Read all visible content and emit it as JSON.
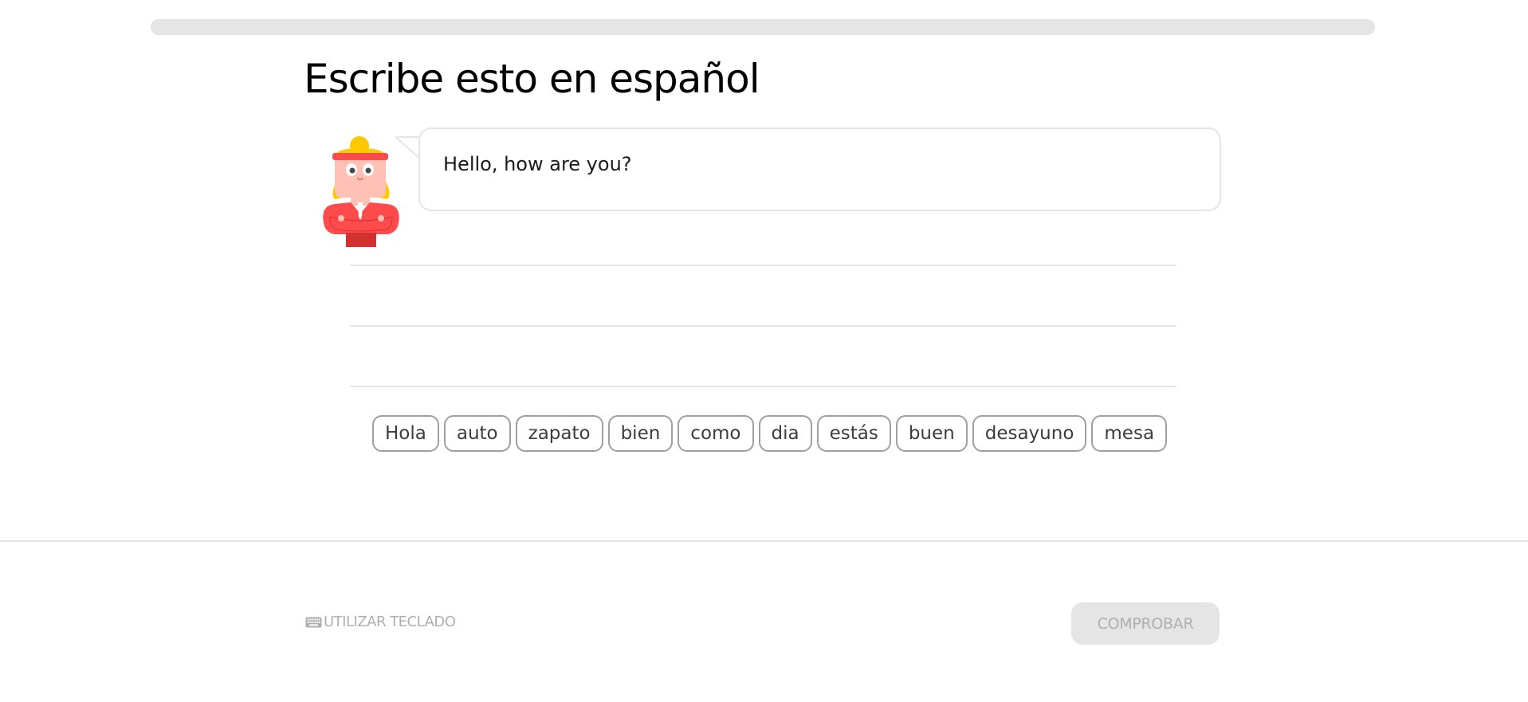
{
  "progress": {
    "fraction": 0
  },
  "exercise": {
    "title": "Escribe esto en español",
    "prompt_text": "Hello, how are you?"
  },
  "word_bank": [
    "Hola",
    "auto",
    "zapato",
    "bien",
    "como",
    "dia",
    "estás",
    "buen",
    "desayuno",
    "mesa"
  ],
  "footer": {
    "keyboard_label": "UTILIZAR TECLADO",
    "check_label": "COMPROBAR"
  },
  "colors": {
    "progress_track": "#e5e5e5",
    "chip_border": "#9f9f9f",
    "disabled_button_bg": "#e5e5e5",
    "disabled_text": "#afafaf",
    "character_shirt": "#ff4b4b",
    "character_hair": "#ffc800"
  },
  "icons": {
    "keyboard": "keyboard-icon",
    "character": "character-illustration"
  }
}
